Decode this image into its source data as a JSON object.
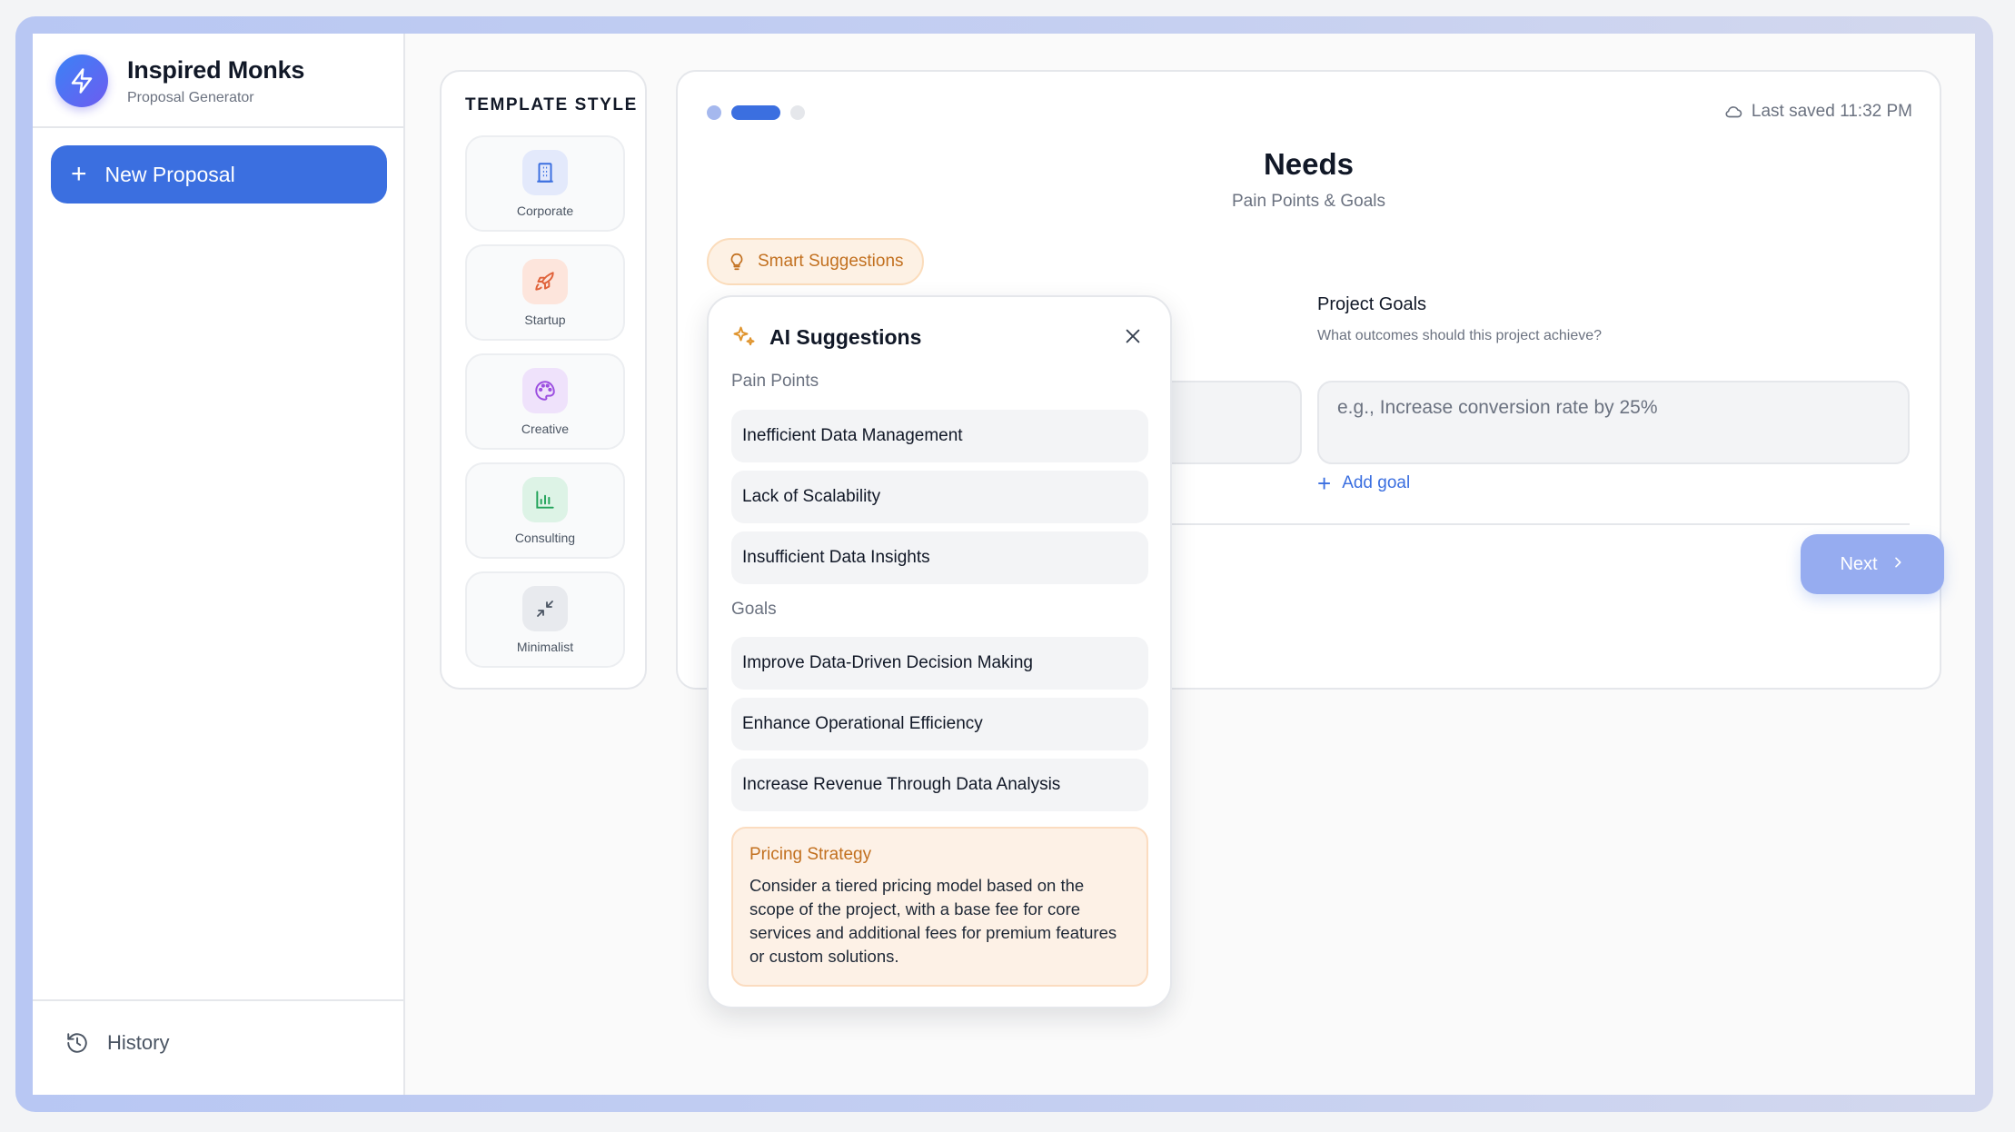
{
  "brand": {
    "title": "Inspired Monks",
    "subtitle": "Proposal Generator"
  },
  "sidebar": {
    "new_proposal": "New Proposal",
    "history": "History"
  },
  "templates": {
    "heading": "TEMPLATE STYLE",
    "items": [
      {
        "label": "Corporate",
        "icon": "building-icon"
      },
      {
        "label": "Startup",
        "icon": "rocket-icon"
      },
      {
        "label": "Creative",
        "icon": "palette-icon"
      },
      {
        "label": "Consulting",
        "icon": "bar-chart-icon"
      },
      {
        "label": "Minimalist",
        "icon": "minimize-icon"
      }
    ]
  },
  "main": {
    "last_saved": "Last saved 11:32 PM",
    "step_title": "Needs",
    "step_subtitle": "Pain Points & Goals",
    "smart_suggestions": "Smart Suggestions",
    "goals_label": "Project Goals",
    "goals_help": "What outcomes should this project achieve?",
    "goals_placeholder": "e.g., Increase conversion rate by 25%",
    "add_goal": "Add goal",
    "next": "Next"
  },
  "suggestions": {
    "title": "AI Suggestions",
    "pain_points_label": "Pain Points",
    "pain_points": [
      "Inefficient Data Management",
      "Lack of Scalability",
      "Insufficient Data Insights"
    ],
    "goals_label": "Goals",
    "goals": [
      "Improve Data-Driven Decision Making",
      "Enhance Operational Efficiency",
      "Increase Revenue Through Data Analysis"
    ],
    "pricing_title": "Pricing Strategy",
    "pricing_body": "Consider a tiered pricing model based on the scope of the project, with a base fee for core services and additional fees for premium features or custom solutions."
  },
  "colors": {
    "accent": "#3b6fe0",
    "suggestion": "#c2701f",
    "suggestion_bg": "#fdf1e6"
  }
}
